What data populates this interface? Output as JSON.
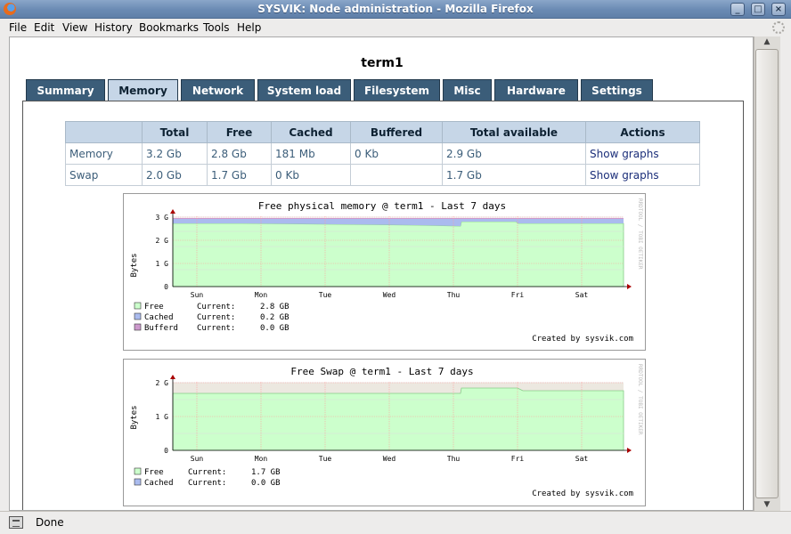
{
  "window": {
    "title": "SYSVIK: Node administration - Mozilla Firefox",
    "controls": {
      "minimize": "_",
      "maximize": "□",
      "close": "×"
    }
  },
  "menu": [
    "File",
    "Edit",
    "View",
    "History",
    "Bookmarks",
    "Tools",
    "Help"
  ],
  "page": {
    "heading": "term1",
    "tabs": [
      "Summary",
      "Memory",
      "Network",
      "System load",
      "Filesystem",
      "Misc",
      "Hardware",
      "Settings"
    ],
    "active_tab": "Memory"
  },
  "memory_table": {
    "columns": [
      "",
      "Total",
      "Free",
      "Cached",
      "Buffered",
      "Total available",
      "Actions"
    ],
    "rows": [
      [
        "Memory",
        "3.2 Gb",
        "2.8 Gb",
        "181 Mb",
        "0 Kb",
        "2.9 Gb",
        "Show graphs"
      ],
      [
        "Swap",
        "2.0 Gb",
        "1.7 Gb",
        "0 Kb",
        "",
        "1.7 Gb",
        "Show graphs"
      ]
    ]
  },
  "graph1": {
    "title": "Free physical memory @ term1 - Last 7 days",
    "ylabel": "Bytes",
    "yticks": [
      "3 G",
      "2 G",
      "1 G",
      "0"
    ],
    "days": [
      "Sun",
      "Mon",
      "Tue",
      "Wed",
      "Thu",
      "Fri",
      "Sat"
    ],
    "side_text": "RRDTOOL / TOBI OETIKER",
    "legend": [
      {
        "name": "Free",
        "label": "Current:",
        "value": "2.8 GB",
        "color": "#ccffcc"
      },
      {
        "name": "Cached",
        "label": "Current:",
        "value": "0.2 GB",
        "color": "#aabbee"
      },
      {
        "name": "Bufferd",
        "label": "Current:",
        "value": "0.0 GB",
        "color": "#cc99cc"
      }
    ],
    "credit": "Created by sysvik.com"
  },
  "graph2": {
    "title": "Free Swap @ term1 - Last 7 days",
    "ylabel": "Bytes",
    "yticks": [
      "2 G",
      "1 G",
      "0"
    ],
    "days": [
      "Sun",
      "Mon",
      "Tue",
      "Wed",
      "Thu",
      "Fri",
      "Sat"
    ],
    "side_text": "RRDTOOL / TOBI OETIKER",
    "legend": [
      {
        "name": "Free",
        "label": "Current:",
        "value": "1.7 GB",
        "color": "#ccffcc"
      },
      {
        "name": "Cached",
        "label": "Current:",
        "value": "0.0 GB",
        "color": "#aabbee"
      }
    ],
    "credit": "Created by sysvik.com"
  },
  "status": {
    "text": "Done"
  },
  "colors": {
    "tab_bg": "#3b5d79",
    "tab_active_bg": "#c6d6e7",
    "table_header_bg": "#c6d6e7",
    "graph_free_fill": "#ccffcc",
    "graph_cached_fill": "#aabbee",
    "graph_grid_major": "#ff9999",
    "graph_grid_minor": "#dddddd"
  }
}
